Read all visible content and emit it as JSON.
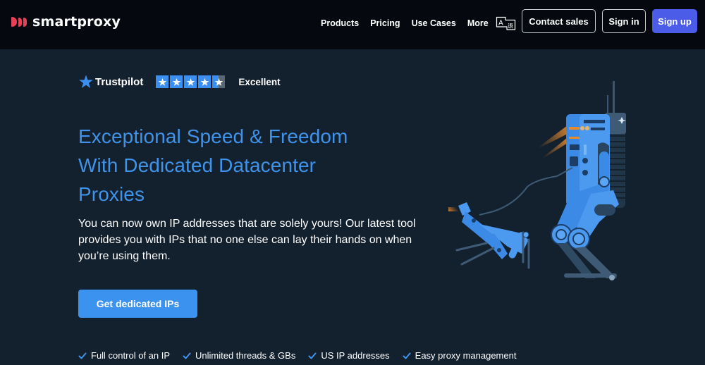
{
  "header": {
    "brand": "smartproxy",
    "nav": [
      {
        "label": "Products"
      },
      {
        "label": "Pricing"
      },
      {
        "label": "Use Cases"
      },
      {
        "label": "More"
      }
    ],
    "language_icon": "translate-icon",
    "contact_sales": "Contact sales",
    "sign_in": "Sign in",
    "sign_up": "Sign up"
  },
  "trustpilot": {
    "brand": "Trustpilot",
    "rating_stars": 4.5,
    "max_stars": 5,
    "rating_label": "Excellent"
  },
  "hero": {
    "title_lines": [
      "Exceptional Speed & Freedom",
      "With Dedicated Datacenter",
      "Proxies"
    ],
    "description": "You can now own IP addresses that are solely yours! Our latest tool provides you with IPs that no one else can lay their hands on when you’re using them.",
    "cta_label": "Get dedicated IPs"
  },
  "features": [
    {
      "label": "Full control of an IP"
    },
    {
      "label": "Unlimited threads & GBs"
    },
    {
      "label": "US IP addresses"
    },
    {
      "label": "Easy proxy management"
    }
  ],
  "colors": {
    "header_bg": "#05090f",
    "page_bg": "#13202e",
    "accent_blue": "#3f93ea",
    "signup_button": "#4a5ce8",
    "logo_red": "#e8415a",
    "trustpilot_star": "#3b8ff0"
  }
}
